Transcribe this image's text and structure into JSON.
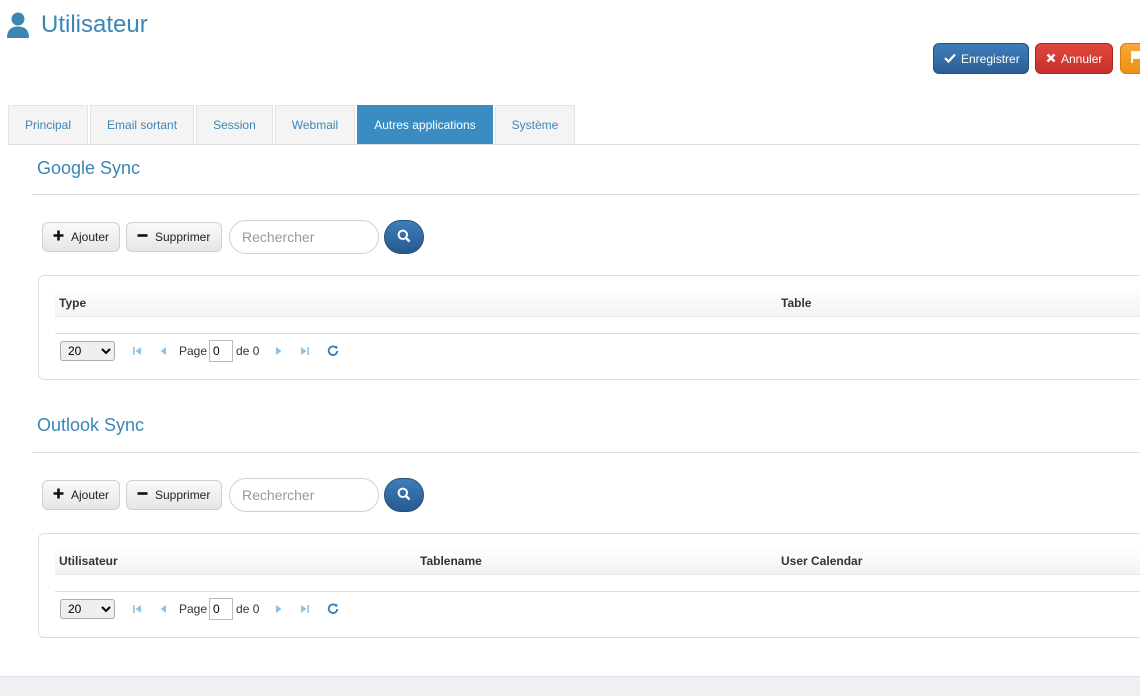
{
  "page": {
    "title": "Utilisateur"
  },
  "toolbar": {
    "save_label": "Enregistrer",
    "cancel_label": "Annuler"
  },
  "tabs": [
    {
      "label": "Principal"
    },
    {
      "label": "Email sortant"
    },
    {
      "label": "Session"
    },
    {
      "label": "Webmail"
    },
    {
      "label": "Autres applications",
      "active": true
    },
    {
      "label": "Système"
    }
  ],
  "google_sync": {
    "title": "Google Sync",
    "add_label": "Ajouter",
    "delete_label": "Supprimer",
    "search_placeholder": "Rechercher",
    "columns": [
      "Type",
      "Table"
    ],
    "pager": {
      "page_size": "20",
      "page_label": "Page",
      "page_value": "0",
      "of_label": "de 0"
    }
  },
  "outlook_sync": {
    "title": "Outlook Sync",
    "add_label": "Ajouter",
    "delete_label": "Supprimer",
    "search_placeholder": "Rechercher",
    "columns": [
      "Utilisateur",
      "Tablename",
      "User Calendar"
    ],
    "pager": {
      "page_size": "20",
      "page_label": "Page",
      "page_value": "0",
      "of_label": "de 0"
    }
  },
  "colors": {
    "accent": "#3c86b4",
    "save": "#2b5f94",
    "cancel": "#c6302a",
    "warning": "#ec8f14"
  },
  "icons": [
    "user-icon",
    "check-icon",
    "times-icon",
    "plus-icon",
    "minus-icon",
    "search-icon",
    "first-page-icon",
    "prev-page-icon",
    "next-page-icon",
    "last-page-icon",
    "refresh-icon"
  ]
}
